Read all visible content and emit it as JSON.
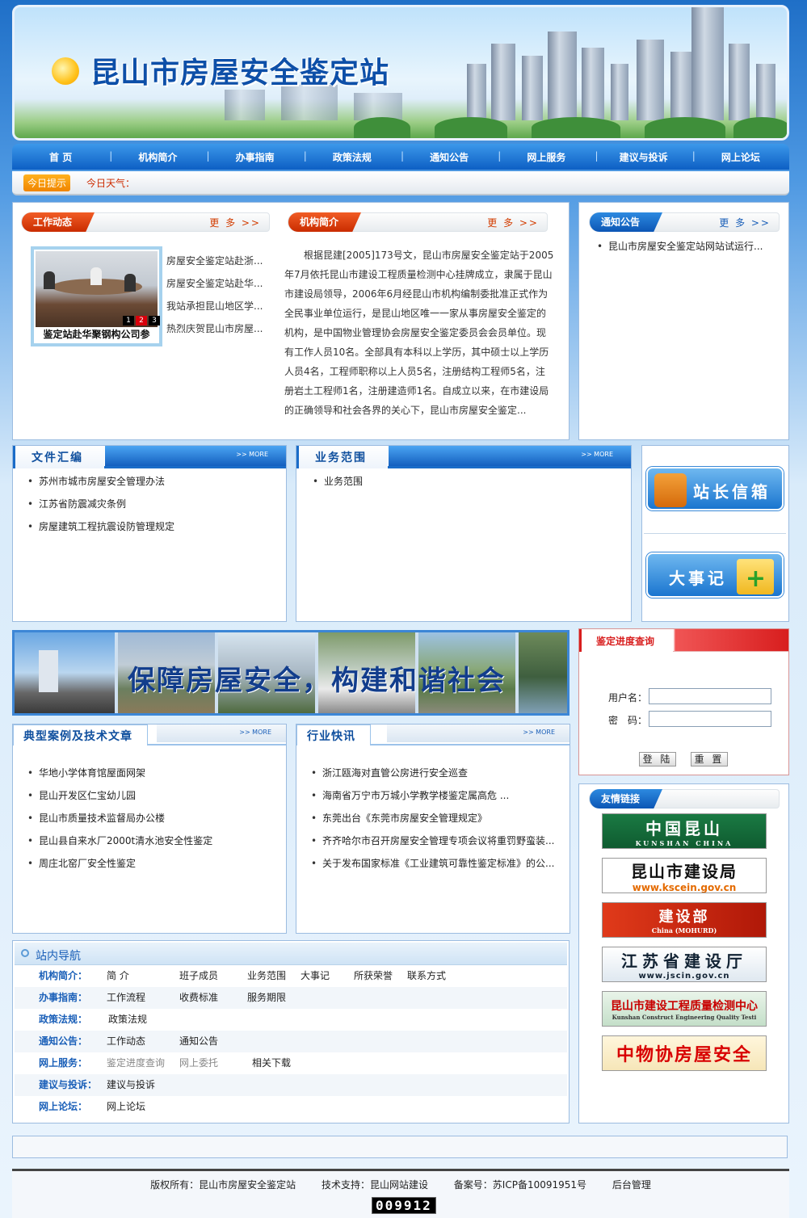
{
  "site": {
    "title": "昆山市房屋安全鉴定站"
  },
  "nav": [
    "首  页",
    "机构简介",
    "办事指南",
    "政策法规",
    "通知公告",
    "网上服务",
    "建议与投诉",
    "网上论坛"
  ],
  "tip": {
    "badge": "今日提示",
    "weather": "今日天气："
  },
  "work_news": {
    "title": "工作动态",
    "more": "更 多 >>",
    "photo_caption": "鉴定站赴华聚钢构公司参",
    "slide_numbers": [
      "1",
      "2",
      "3"
    ],
    "items": [
      "房屋安全鉴定站赴浙...",
      "房屋安全鉴定站赴华...",
      "我站承担昆山地区学...",
      "热烈庆贺昆山市房屋..."
    ]
  },
  "intro": {
    "title": "机构简介",
    "more": "更 多 >>",
    "text": "根据昆建[2005]173号文，昆山市房屋安全鉴定站于2005年7月依托昆山市建设工程质量检测中心挂牌成立，隶属于昆山市建设局领导，2006年6月经昆山市机构编制委批准正式作为全民事业单位运行，是昆山地区唯一一家从事房屋安全鉴定的机构，是中国物业管理协会房屋安全鉴定委员会会员单位。现有工作人员10名。全部具有本科以上学历，其中硕士以上学历人员4名，工程师职称以上人员5名，注册结构工程师5名，注册岩土工程师1名，注册建造师1名。自成立以来，在市建设局的正确领导和社会各界的关心下，昆山市房屋安全鉴定..."
  },
  "notice": {
    "title": "通知公告",
    "more": "更 多 >>",
    "items": [
      "昆山市房屋安全鉴定站网站试运行..."
    ]
  },
  "docs": {
    "title": "文件汇编",
    "more": ">> MORE",
    "items": [
      "苏州市城市房屋安全管理办法",
      "江苏省防震减灾条例",
      "房屋建筑工程抗震设防管理规定"
    ]
  },
  "scope": {
    "title": "业务范围",
    "more": ">> MORE",
    "items": [
      "业务范围"
    ]
  },
  "side_buttons": {
    "mailbox": "站长信箱",
    "events": "大事记"
  },
  "slogan": "保障房屋安全，构建和谐社会",
  "progress": {
    "title": "鉴定进度查询",
    "user_label": "用户名：",
    "pwd_label": "密　码：",
    "user_value": "",
    "pwd_value": "",
    "login": "登 陆",
    "reset": "重 置"
  },
  "cases": {
    "title": "典型案例及技术文章",
    "more": ">> MORE",
    "items": [
      "华地小学体育馆屋面网架",
      "昆山开发区仁宝幼儿园",
      "昆山市质量技术监督局办公楼",
      "昆山县自来水厂2000t清水池安全性鉴定",
      "周庄北窑厂安全性鉴定"
    ]
  },
  "industry": {
    "title": "行业快讯",
    "more": ">> MORE",
    "items": [
      "浙江瓯海对直管公房进行安全巡查",
      "海南省万宁市万城小学教学楼鉴定属高危 ...",
      "东莞出台《东莞市房屋安全管理规定》",
      "齐齐哈尔市召开房屋安全管理专项会议将重罚野蛮装...",
      "关于发布国家标准《工业建筑可靠性鉴定标准》的公..."
    ]
  },
  "friends": {
    "title": "友情链接",
    "links": [
      {
        "name": "中国昆山",
        "sub": "KUNSHAN CHINA"
      },
      {
        "name": "昆山市建设局",
        "sub": "www.kscein.gov.cn"
      },
      {
        "name": "建设部",
        "sub": "China (MOHURD)"
      },
      {
        "name": "江苏省建设厅",
        "sub": "www.jscin.gov.cn"
      },
      {
        "name": "昆山市建设工程质量检测中心",
        "sub": "Kunshan Construct Engineering Quality Testi"
      },
      {
        "name": "中物协房屋安全",
        "sub": ""
      }
    ]
  },
  "sitenav": {
    "title": "站内导航",
    "rows": [
      {
        "cat": "机构简介：",
        "links": [
          "简  介",
          "班子成员",
          "业务范围",
          "大事记",
          "所获荣誉",
          "联系方式"
        ]
      },
      {
        "cat": "办事指南：",
        "links": [
          "工作流程",
          "收费标准",
          "服务期限"
        ]
      },
      {
        "cat": "政策法规：",
        "links": [
          "政策法规"
        ]
      },
      {
        "cat": "通知公告：",
        "links": [
          "工作动态",
          "通知公告"
        ]
      },
      {
        "cat": "网上服务：",
        "links": [
          "鉴定进度查询",
          "网上委托",
          "相关下载"
        ]
      },
      {
        "cat": "建议与投诉：",
        "links": [
          "建议与投诉"
        ]
      },
      {
        "cat": "网上论坛：",
        "links": [
          "网上论坛"
        ]
      }
    ]
  },
  "footer": {
    "copyright": "版权所有：昆山市房屋安全鉴定站",
    "tech": "技术支持：昆山网站建设",
    "icp": "备案号：苏ICP备10091951号",
    "admin": "后台管理",
    "counter": "009912"
  }
}
